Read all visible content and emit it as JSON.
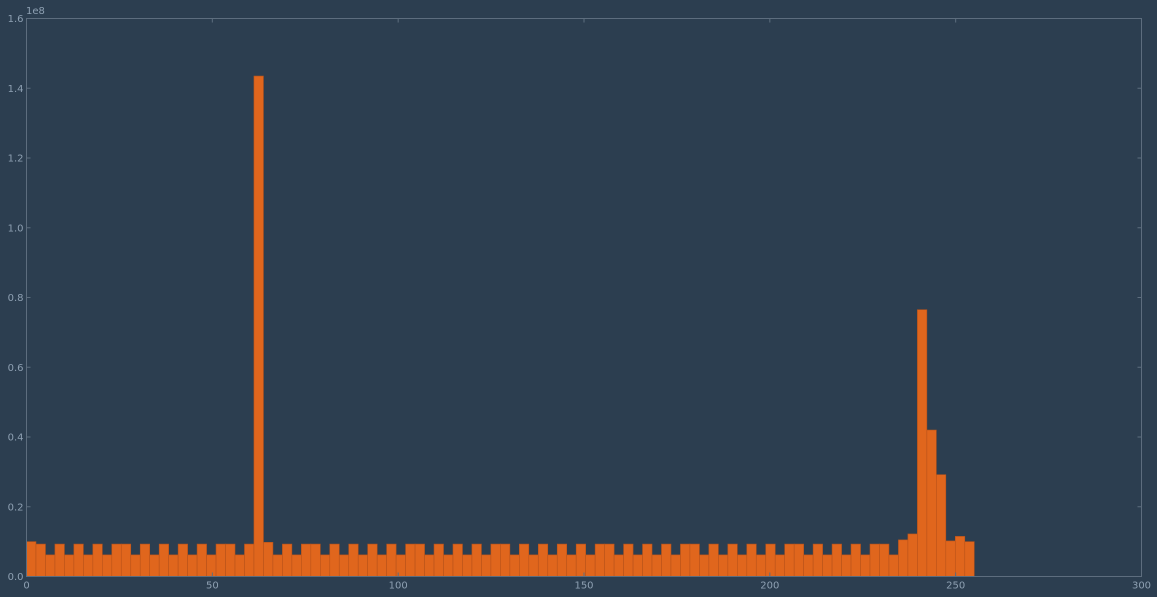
{
  "colors": {
    "background": "#2c3e50",
    "bar_fill": "#e0661d",
    "bar_edge": "#b9531a",
    "axis": "#5d6d7e",
    "tick_text": "#8ea0b2"
  },
  "chart_data": {
    "type": "bar",
    "title": "",
    "xlabel": "",
    "ylabel": "",
    "y_offset_label": "1e8",
    "y_scale": 100000000,
    "xlim": [
      0,
      300
    ],
    "ylim": [
      0,
      1.6
    ],
    "bin_width": 2.55,
    "x_ticks": [
      0,
      50,
      100,
      150,
      200,
      250,
      300
    ],
    "x_tick_labels": [
      "0",
      "50",
      "100",
      "150",
      "200",
      "250",
      "300"
    ],
    "y_ticks": [
      0.0,
      0.2,
      0.4,
      0.6,
      0.8,
      1.0,
      1.2,
      1.4,
      1.6
    ],
    "y_tick_labels": [
      "0.0",
      "0.2",
      "0.4",
      "0.6",
      "0.8",
      "1.0",
      "1.2",
      "1.4",
      "1.6"
    ],
    "grid": false,
    "bins_start": [
      0,
      2.55,
      5.1,
      7.65,
      10.2,
      12.75,
      15.3,
      17.85,
      20.4,
      22.95,
      25.5,
      28.05,
      30.6,
      33.15,
      35.7,
      38.25,
      40.8,
      43.35,
      45.9,
      48.45,
      51.0,
      53.55,
      56.1,
      58.65,
      61.2,
      63.75,
      66.3,
      68.85,
      71.4,
      73.95,
      76.5,
      79.05,
      81.6,
      84.15,
      86.7,
      89.25,
      91.8,
      94.35,
      96.9,
      99.45,
      102.0,
      104.55,
      107.1,
      109.65,
      112.2,
      114.75,
      117.3,
      119.85,
      122.4,
      124.95,
      127.5,
      130.05,
      132.6,
      135.15,
      137.7,
      140.25,
      142.8,
      145.35,
      147.9,
      150.45,
      153.0,
      155.55,
      158.1,
      160.65,
      163.2,
      165.75,
      168.3,
      170.85,
      173.4,
      175.95,
      178.5,
      181.05,
      183.6,
      186.15,
      188.7,
      191.25,
      193.8,
      196.35,
      198.9,
      201.45,
      204.0,
      206.55,
      209.1,
      211.65,
      214.2,
      216.75,
      219.3,
      221.85,
      224.4,
      226.95,
      229.5,
      232.05,
      234.6,
      237.15,
      239.7,
      242.25,
      244.8,
      247.35,
      249.9,
      252.45
    ],
    "values": [
      0.1,
      0.093,
      0.062,
      0.093,
      0.062,
      0.093,
      0.062,
      0.093,
      0.062,
      0.093,
      0.093,
      0.062,
      0.093,
      0.062,
      0.093,
      0.062,
      0.093,
      0.062,
      0.093,
      0.062,
      0.093,
      0.093,
      0.062,
      0.093,
      1.435,
      0.098,
      0.062,
      0.093,
      0.062,
      0.093,
      0.093,
      0.062,
      0.093,
      0.062,
      0.093,
      0.062,
      0.093,
      0.062,
      0.093,
      0.062,
      0.093,
      0.093,
      0.062,
      0.093,
      0.062,
      0.093,
      0.062,
      0.093,
      0.062,
      0.093,
      0.093,
      0.062,
      0.093,
      0.062,
      0.093,
      0.062,
      0.093,
      0.062,
      0.093,
      0.062,
      0.093,
      0.093,
      0.062,
      0.093,
      0.062,
      0.093,
      0.062,
      0.093,
      0.062,
      0.093,
      0.093,
      0.062,
      0.093,
      0.062,
      0.093,
      0.062,
      0.093,
      0.062,
      0.093,
      0.062,
      0.093,
      0.093,
      0.062,
      0.093,
      0.062,
      0.093,
      0.062,
      0.093,
      0.062,
      0.093,
      0.093,
      0.062,
      0.105,
      0.122,
      0.765,
      0.42,
      0.292,
      0.102,
      0.115,
      0.1
    ]
  }
}
